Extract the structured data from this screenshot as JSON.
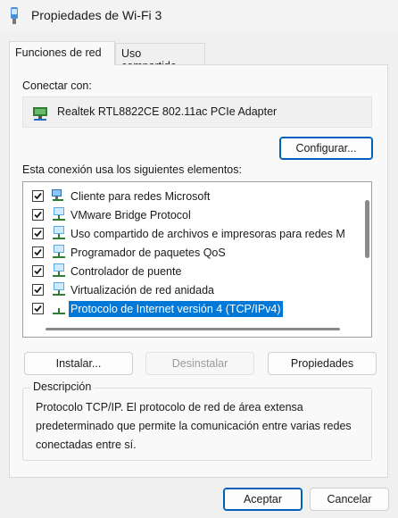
{
  "window": {
    "title": "Propiedades de Wi-Fi 3"
  },
  "tabs": [
    {
      "label": "Funciones de red",
      "active": true
    },
    {
      "label": "Uso compartido",
      "active": false
    }
  ],
  "connect": {
    "label": "Conectar con:",
    "adapter": "Realtek RTL8822CE 802.11ac PCIe Adapter",
    "configure_button": "Configurar..."
  },
  "items_label": "Esta conexión usa los siguientes elementos:",
  "items": [
    {
      "label": "Cliente para redes Microsoft",
      "checked": true,
      "icon": "network-client-icon"
    },
    {
      "label": "VMware Bridge Protocol",
      "checked": true,
      "icon": "network-protocol-icon"
    },
    {
      "label": "Uso compartido de archivos e impresoras para redes M",
      "checked": true,
      "icon": "network-service-icon"
    },
    {
      "label": "Programador de paquetes QoS",
      "checked": true,
      "icon": "network-service-icon"
    },
    {
      "label": "Controlador de puente",
      "checked": true,
      "icon": "network-protocol-icon"
    },
    {
      "label": "Virtualización de red anidada",
      "checked": true,
      "icon": "network-protocol-icon"
    },
    {
      "label": "Protocolo de Internet versión 4 (TCP/IPv4)",
      "checked": true,
      "icon": "network-protocol-icon",
      "selected": true
    }
  ],
  "actions": {
    "install": "Instalar...",
    "uninstall": "Desinstalar",
    "properties": "Propiedades"
  },
  "description": {
    "legend": "Descripción",
    "text": "Protocolo TCP/IP. El protocolo de red de área extensa predeterminado que permite la comunicación entre varias redes conectadas entre sí."
  },
  "footer": {
    "ok": "Aceptar",
    "cancel": "Cancelar"
  },
  "colors": {
    "selection": "#0078d7",
    "accent_border": "#005fb8",
    "window_bg": "#f0f0f0",
    "panel_bg": "#f9f9f9"
  }
}
